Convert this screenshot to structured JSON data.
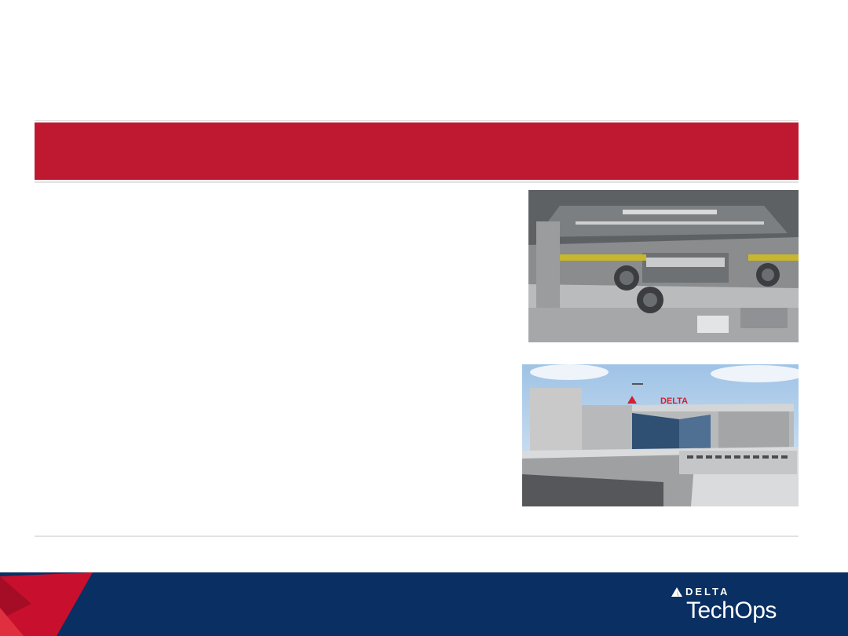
{
  "slide": {
    "title": "",
    "body_text": ""
  },
  "images": {
    "hangar": {
      "alt": ""
    },
    "building": {
      "sign": "DELTA"
    }
  },
  "branding": {
    "logo_word": "DELTA",
    "logo_sub": "TechOps",
    "colors": {
      "title_band": "#be1931",
      "footer": "#0a2f63",
      "accent_red": "#d3202f"
    }
  }
}
